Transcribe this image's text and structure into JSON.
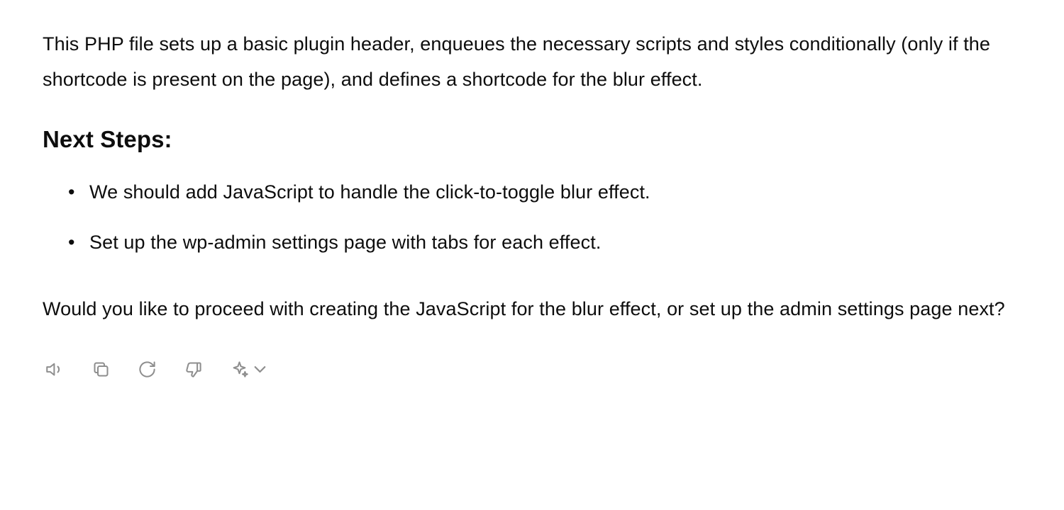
{
  "content": {
    "intro": "This PHP file sets up a basic plugin header, enqueues the necessary scripts and styles conditionally (only if the shortcode is present on the page), and defines a shortcode for the blur effect.",
    "heading": "Next Steps:",
    "steps": [
      "We should add JavaScript to handle the click-to-toggle blur effect.",
      "Set up the wp-admin settings page with tabs for each effect."
    ],
    "outro": "Would you like to proceed with creating the JavaScript for the blur effect, or set up the admin settings page next?"
  },
  "actions": {
    "speaker": "speaker",
    "copy": "copy",
    "regenerate": "regenerate",
    "dislike": "dislike",
    "sparkle": "sparkle"
  }
}
